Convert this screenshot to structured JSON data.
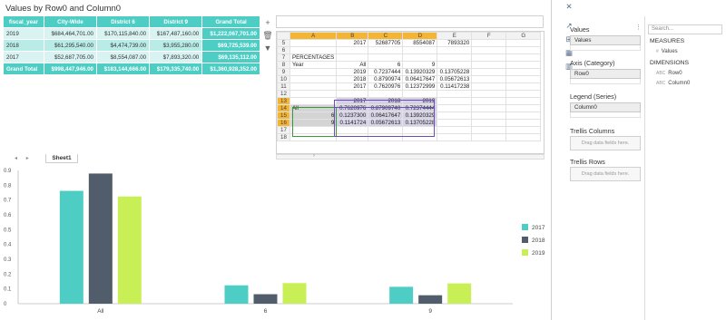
{
  "title": "Values by Row0 and Column0",
  "pivot": {
    "headers": [
      "fiscal_year",
      "City-Wide",
      "District 6",
      "District 9",
      "Grand Total"
    ],
    "rows": [
      [
        "2019",
        "$684,464,701.00",
        "$170,115,840.00",
        "$167,487,160.00",
        "$1,222,067,701.00"
      ],
      [
        "2018",
        "$61,295,540.00",
        "$4,474,739.00",
        "$3,955,280.00",
        "$69,725,539.00"
      ],
      [
        "2017",
        "$52,687,705.00",
        "$8,554,087.00",
        "$7,893,320.00",
        "$69,135,112.00"
      ],
      [
        "Grand Total",
        "$998,447,946.00",
        "$183,144,666.00",
        "$179,335,740.00",
        "$1,360,928,352.00"
      ]
    ]
  },
  "sheet_tools": [
    "+",
    "🗑",
    "▼"
  ],
  "sheet": {
    "columns": [
      "A",
      "B",
      "C",
      "D",
      "E",
      "F",
      "G"
    ],
    "rows": [
      {
        "n": "5",
        "cells": [
          "",
          "2017",
          "52687705",
          "8554087",
          "7893320",
          "",
          ""
        ]
      },
      {
        "n": "6",
        "cells": [
          "",
          "",
          "",
          "",
          "",
          "",
          ""
        ]
      },
      {
        "n": "7",
        "cells": [
          "PERCENTAGES",
          "",
          "",
          "",
          "",
          "",
          ""
        ]
      },
      {
        "n": "8",
        "cells": [
          "Year",
          "All",
          "6",
          "9",
          "",
          "",
          ""
        ]
      },
      {
        "n": "9",
        "cells": [
          "",
          "2019",
          "0.7237444",
          "0.13920329",
          "0.13705228",
          "",
          ""
        ]
      },
      {
        "n": "10",
        "cells": [
          "",
          "2018",
          "0.8790974",
          "0.06417647",
          "0.05672613",
          "",
          ""
        ]
      },
      {
        "n": "11",
        "cells": [
          "",
          "2017",
          "0.7620976",
          "0.12372999",
          "0.11417238",
          "",
          ""
        ]
      },
      {
        "n": "12",
        "cells": [
          "",
          "",
          "",
          "",
          "",
          "",
          ""
        ]
      },
      {
        "n": "13",
        "cells": [
          "",
          "2017",
          "2018",
          "2019",
          "",
          "",
          ""
        ]
      },
      {
        "n": "14",
        "cells": [
          "All",
          "0.7620976",
          "0.87909740",
          "0.72374444",
          "",
          "",
          ""
        ]
      },
      {
        "n": "15",
        "cells": [
          "6",
          "0.1237300",
          "0.06417647",
          "0.13920329",
          "",
          "",
          ""
        ]
      },
      {
        "n": "16",
        "cells": [
          "9",
          "0.1141724",
          "0.05672613",
          "0.13705228",
          "",
          "",
          ""
        ]
      },
      {
        "n": "17",
        "cells": [
          "",
          "",
          "",
          "",
          "",
          "",
          ""
        ]
      },
      {
        "n": "18",
        "cells": [
          "",
          "",
          "",
          "",
          "",
          "",
          ""
        ]
      }
    ],
    "scroll_arrow": "›"
  },
  "tabs": {
    "nav_prev": "◂",
    "nav_next": "▸",
    "active": "Sheet1"
  },
  "chart_data": {
    "type": "bar",
    "categories": [
      "All",
      "6",
      "9"
    ],
    "series": [
      {
        "name": "2017",
        "values": [
          0.762,
          0.124,
          0.114
        ],
        "color": "#4ecdc4"
      },
      {
        "name": "2018",
        "values": [
          0.879,
          0.064,
          0.057
        ],
        "color": "#515d6b"
      },
      {
        "name": "2019",
        "values": [
          0.724,
          0.139,
          0.137
        ],
        "color": "#c8f056"
      }
    ],
    "yticks": [
      "0",
      "0.1",
      "0.2",
      "0.3",
      "0.4",
      "0.5",
      "0.6",
      "0.7",
      "0.8",
      "0.9"
    ],
    "ylim": [
      0,
      0.9
    ],
    "legend": "right",
    "xlabel": "",
    "ylabel": ""
  },
  "icon_strip": [
    "✕",
    "↗",
    "⊞",
    "▦",
    "▥"
  ],
  "wells": {
    "values_label": "Values",
    "values_pill": "Values",
    "menu_dots": "⋮",
    "axis_label": "Axis (Category)",
    "axis_pill": "Row0",
    "legend_label": "Legend (Series)",
    "legend_pill": "Column0",
    "trellis_cols_label": "Trellis Columns",
    "trellis_cols_drop": "Drag data fields here.",
    "trellis_rows_label": "Trellis Rows",
    "trellis_rows_drop": "Drag data fields here."
  },
  "fields": {
    "search_placeholder": "Search...",
    "measures_label": "MEASURES",
    "measures": [
      {
        "icon": "#",
        "name": "Values"
      }
    ],
    "dimensions_label": "DIMENSIONS",
    "dimensions": [
      {
        "icon": "ABC",
        "name": "Row0"
      },
      {
        "icon": "ABC",
        "name": "Column0"
      }
    ]
  }
}
